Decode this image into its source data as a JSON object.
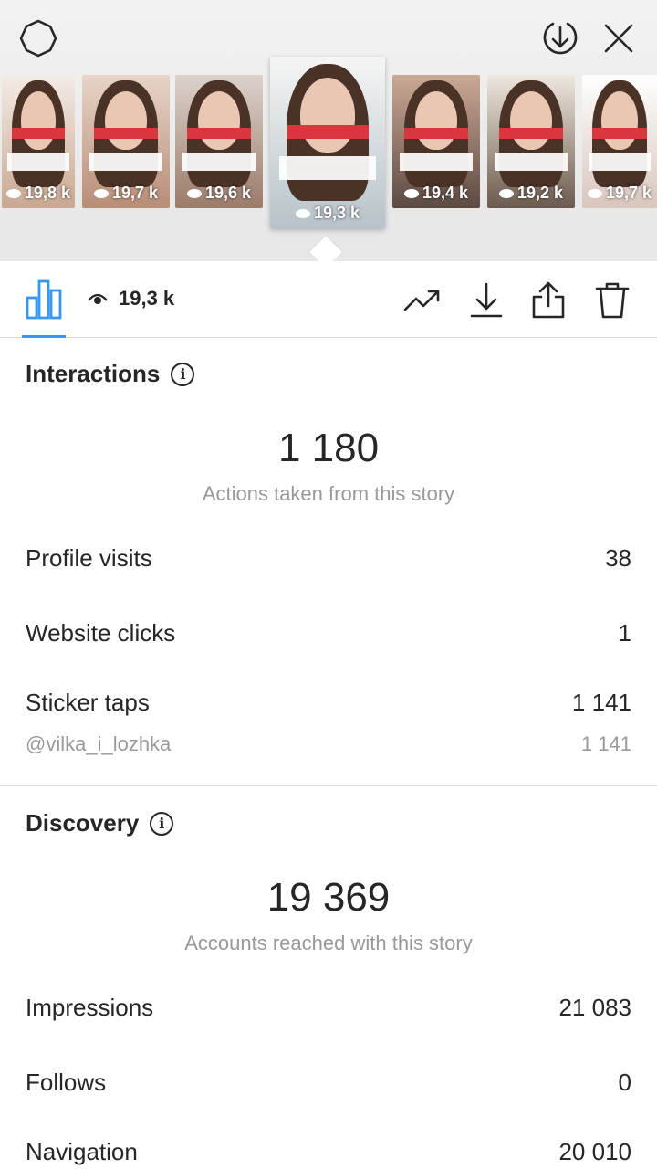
{
  "header": {
    "settings_icon": "settings-gear-icon",
    "save_icon": "download-circle-icon",
    "close_icon": "close-icon"
  },
  "stories": [
    {
      "views": "19,8 k",
      "colors": [
        "#c9a891",
        "#f3ece6"
      ]
    },
    {
      "views": "19,7 k",
      "colors": [
        "#b88d77",
        "#e7d5c8"
      ]
    },
    {
      "views": "19,6 k",
      "colors": [
        "#9b7b6a",
        "#dcd3cc"
      ]
    },
    {
      "views": "19,3 k",
      "colors": [
        "#b7c3c9",
        "#f5f5f5"
      ],
      "selected": true
    },
    {
      "views": "19,4 k",
      "colors": [
        "#5d4a42",
        "#cba895"
      ]
    },
    {
      "views": "19,2 k",
      "colors": [
        "#6b5a4d",
        "#efe8df"
      ]
    },
    {
      "views": "19,7 k",
      "colors": [
        "#d9c6bd",
        "#ffffff"
      ]
    }
  ],
  "toolbar": {
    "views": "19,3 k",
    "icons": [
      "bar-chart-icon",
      "eye-icon",
      "trend-up-icon",
      "download-icon",
      "share-icon",
      "trash-icon"
    ]
  },
  "interactions": {
    "title": "Interactions",
    "total": "1 180",
    "subtitle": "Actions taken from this story",
    "rows": [
      {
        "label": "Profile visits",
        "value": "38"
      },
      {
        "label": "Website clicks",
        "value": "1"
      },
      {
        "label": "Sticker taps",
        "value": "1 141"
      }
    ],
    "sticker_handle": {
      "label": "@vilka_i_lozhka",
      "value": "1 141"
    }
  },
  "discovery": {
    "title": "Discovery",
    "total": "19 369",
    "subtitle": "Accounts reached with this story",
    "rows": [
      {
        "label": "Impressions",
        "value": "21 083"
      },
      {
        "label": "Follows",
        "value": "0"
      },
      {
        "label": "Navigation",
        "value": "20 010"
      }
    ]
  },
  "colors": {
    "accent": "#3897f0",
    "text": "#262626",
    "muted": "#999999"
  }
}
